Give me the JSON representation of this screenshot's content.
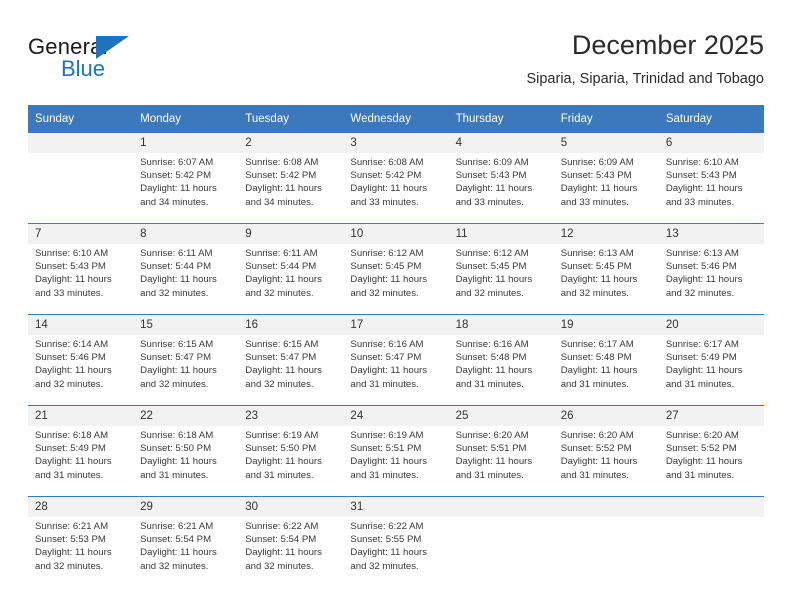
{
  "brand": {
    "name_part1": "General",
    "name_part2": "Blue",
    "triangle_color": "#1f72bd"
  },
  "header": {
    "title": "December 2025",
    "subtitle": "Siparia, Siparia, Trinidad and Tobago"
  },
  "theme": {
    "header_bg": "#3b78bc",
    "header_text": "#ffffff",
    "daynum_bg": "#f2f2f2",
    "grid_line": "#3b78bc"
  },
  "weekdays": [
    "Sunday",
    "Monday",
    "Tuesday",
    "Wednesday",
    "Thursday",
    "Friday",
    "Saturday"
  ],
  "labels": {
    "sunrise_prefix": "Sunrise:",
    "sunset_prefix": "Sunset:",
    "daylight_prefix": "Daylight:"
  },
  "weeks": [
    [
      {
        "day": "",
        "blank": true,
        "sunrise": "",
        "sunset": "",
        "daylight_line1": "",
        "daylight_line2": ""
      },
      {
        "day": "1",
        "sunrise": "Sunrise: 6:07 AM",
        "sunset": "Sunset: 5:42 PM",
        "daylight_line1": "Daylight: 11 hours",
        "daylight_line2": "and 34 minutes."
      },
      {
        "day": "2",
        "sunrise": "Sunrise: 6:08 AM",
        "sunset": "Sunset: 5:42 PM",
        "daylight_line1": "Daylight: 11 hours",
        "daylight_line2": "and 34 minutes."
      },
      {
        "day": "3",
        "sunrise": "Sunrise: 6:08 AM",
        "sunset": "Sunset: 5:42 PM",
        "daylight_line1": "Daylight: 11 hours",
        "daylight_line2": "and 33 minutes."
      },
      {
        "day": "4",
        "sunrise": "Sunrise: 6:09 AM",
        "sunset": "Sunset: 5:43 PM",
        "daylight_line1": "Daylight: 11 hours",
        "daylight_line2": "and 33 minutes."
      },
      {
        "day": "5",
        "sunrise": "Sunrise: 6:09 AM",
        "sunset": "Sunset: 5:43 PM",
        "daylight_line1": "Daylight: 11 hours",
        "daylight_line2": "and 33 minutes."
      },
      {
        "day": "6",
        "sunrise": "Sunrise: 6:10 AM",
        "sunset": "Sunset: 5:43 PM",
        "daylight_line1": "Daylight: 11 hours",
        "daylight_line2": "and 33 minutes."
      }
    ],
    [
      {
        "day": "7",
        "sunrise": "Sunrise: 6:10 AM",
        "sunset": "Sunset: 5:43 PM",
        "daylight_line1": "Daylight: 11 hours",
        "daylight_line2": "and 33 minutes."
      },
      {
        "day": "8",
        "sunrise": "Sunrise: 6:11 AM",
        "sunset": "Sunset: 5:44 PM",
        "daylight_line1": "Daylight: 11 hours",
        "daylight_line2": "and 32 minutes."
      },
      {
        "day": "9",
        "sunrise": "Sunrise: 6:11 AM",
        "sunset": "Sunset: 5:44 PM",
        "daylight_line1": "Daylight: 11 hours",
        "daylight_line2": "and 32 minutes."
      },
      {
        "day": "10",
        "sunrise": "Sunrise: 6:12 AM",
        "sunset": "Sunset: 5:45 PM",
        "daylight_line1": "Daylight: 11 hours",
        "daylight_line2": "and 32 minutes."
      },
      {
        "day": "11",
        "sunrise": "Sunrise: 6:12 AM",
        "sunset": "Sunset: 5:45 PM",
        "daylight_line1": "Daylight: 11 hours",
        "daylight_line2": "and 32 minutes."
      },
      {
        "day": "12",
        "sunrise": "Sunrise: 6:13 AM",
        "sunset": "Sunset: 5:45 PM",
        "daylight_line1": "Daylight: 11 hours",
        "daylight_line2": "and 32 minutes."
      },
      {
        "day": "13",
        "sunrise": "Sunrise: 6:13 AM",
        "sunset": "Sunset: 5:46 PM",
        "daylight_line1": "Daylight: 11 hours",
        "daylight_line2": "and 32 minutes."
      }
    ],
    [
      {
        "day": "14",
        "sunrise": "Sunrise: 6:14 AM",
        "sunset": "Sunset: 5:46 PM",
        "daylight_line1": "Daylight: 11 hours",
        "daylight_line2": "and 32 minutes."
      },
      {
        "day": "15",
        "sunrise": "Sunrise: 6:15 AM",
        "sunset": "Sunset: 5:47 PM",
        "daylight_line1": "Daylight: 11 hours",
        "daylight_line2": "and 32 minutes."
      },
      {
        "day": "16",
        "sunrise": "Sunrise: 6:15 AM",
        "sunset": "Sunset: 5:47 PM",
        "daylight_line1": "Daylight: 11 hours",
        "daylight_line2": "and 32 minutes."
      },
      {
        "day": "17",
        "sunrise": "Sunrise: 6:16 AM",
        "sunset": "Sunset: 5:47 PM",
        "daylight_line1": "Daylight: 11 hours",
        "daylight_line2": "and 31 minutes."
      },
      {
        "day": "18",
        "sunrise": "Sunrise: 6:16 AM",
        "sunset": "Sunset: 5:48 PM",
        "daylight_line1": "Daylight: 11 hours",
        "daylight_line2": "and 31 minutes."
      },
      {
        "day": "19",
        "sunrise": "Sunrise: 6:17 AM",
        "sunset": "Sunset: 5:48 PM",
        "daylight_line1": "Daylight: 11 hours",
        "daylight_line2": "and 31 minutes."
      },
      {
        "day": "20",
        "sunrise": "Sunrise: 6:17 AM",
        "sunset": "Sunset: 5:49 PM",
        "daylight_line1": "Daylight: 11 hours",
        "daylight_line2": "and 31 minutes."
      }
    ],
    [
      {
        "day": "21",
        "sunrise": "Sunrise: 6:18 AM",
        "sunset": "Sunset: 5:49 PM",
        "daylight_line1": "Daylight: 11 hours",
        "daylight_line2": "and 31 minutes."
      },
      {
        "day": "22",
        "sunrise": "Sunrise: 6:18 AM",
        "sunset": "Sunset: 5:50 PM",
        "daylight_line1": "Daylight: 11 hours",
        "daylight_line2": "and 31 minutes."
      },
      {
        "day": "23",
        "sunrise": "Sunrise: 6:19 AM",
        "sunset": "Sunset: 5:50 PM",
        "daylight_line1": "Daylight: 11 hours",
        "daylight_line2": "and 31 minutes."
      },
      {
        "day": "24",
        "sunrise": "Sunrise: 6:19 AM",
        "sunset": "Sunset: 5:51 PM",
        "daylight_line1": "Daylight: 11 hours",
        "daylight_line2": "and 31 minutes."
      },
      {
        "day": "25",
        "sunrise": "Sunrise: 6:20 AM",
        "sunset": "Sunset: 5:51 PM",
        "daylight_line1": "Daylight: 11 hours",
        "daylight_line2": "and 31 minutes."
      },
      {
        "day": "26",
        "sunrise": "Sunrise: 6:20 AM",
        "sunset": "Sunset: 5:52 PM",
        "daylight_line1": "Daylight: 11 hours",
        "daylight_line2": "and 31 minutes."
      },
      {
        "day": "27",
        "sunrise": "Sunrise: 6:20 AM",
        "sunset": "Sunset: 5:52 PM",
        "daylight_line1": "Daylight: 11 hours",
        "daylight_line2": "and 31 minutes."
      }
    ],
    [
      {
        "day": "28",
        "sunrise": "Sunrise: 6:21 AM",
        "sunset": "Sunset: 5:53 PM",
        "daylight_line1": "Daylight: 11 hours",
        "daylight_line2": "and 32 minutes."
      },
      {
        "day": "29",
        "sunrise": "Sunrise: 6:21 AM",
        "sunset": "Sunset: 5:54 PM",
        "daylight_line1": "Daylight: 11 hours",
        "daylight_line2": "and 32 minutes."
      },
      {
        "day": "30",
        "sunrise": "Sunrise: 6:22 AM",
        "sunset": "Sunset: 5:54 PM",
        "daylight_line1": "Daylight: 11 hours",
        "daylight_line2": "and 32 minutes."
      },
      {
        "day": "31",
        "sunrise": "Sunrise: 6:22 AM",
        "sunset": "Sunset: 5:55 PM",
        "daylight_line1": "Daylight: 11 hours",
        "daylight_line2": "and 32 minutes."
      },
      {
        "day": "",
        "blank": true,
        "sunrise": "",
        "sunset": "",
        "daylight_line1": "",
        "daylight_line2": ""
      },
      {
        "day": "",
        "blank": true,
        "sunrise": "",
        "sunset": "",
        "daylight_line1": "",
        "daylight_line2": ""
      },
      {
        "day": "",
        "blank": true,
        "sunrise": "",
        "sunset": "",
        "daylight_line1": "",
        "daylight_line2": ""
      }
    ]
  ]
}
